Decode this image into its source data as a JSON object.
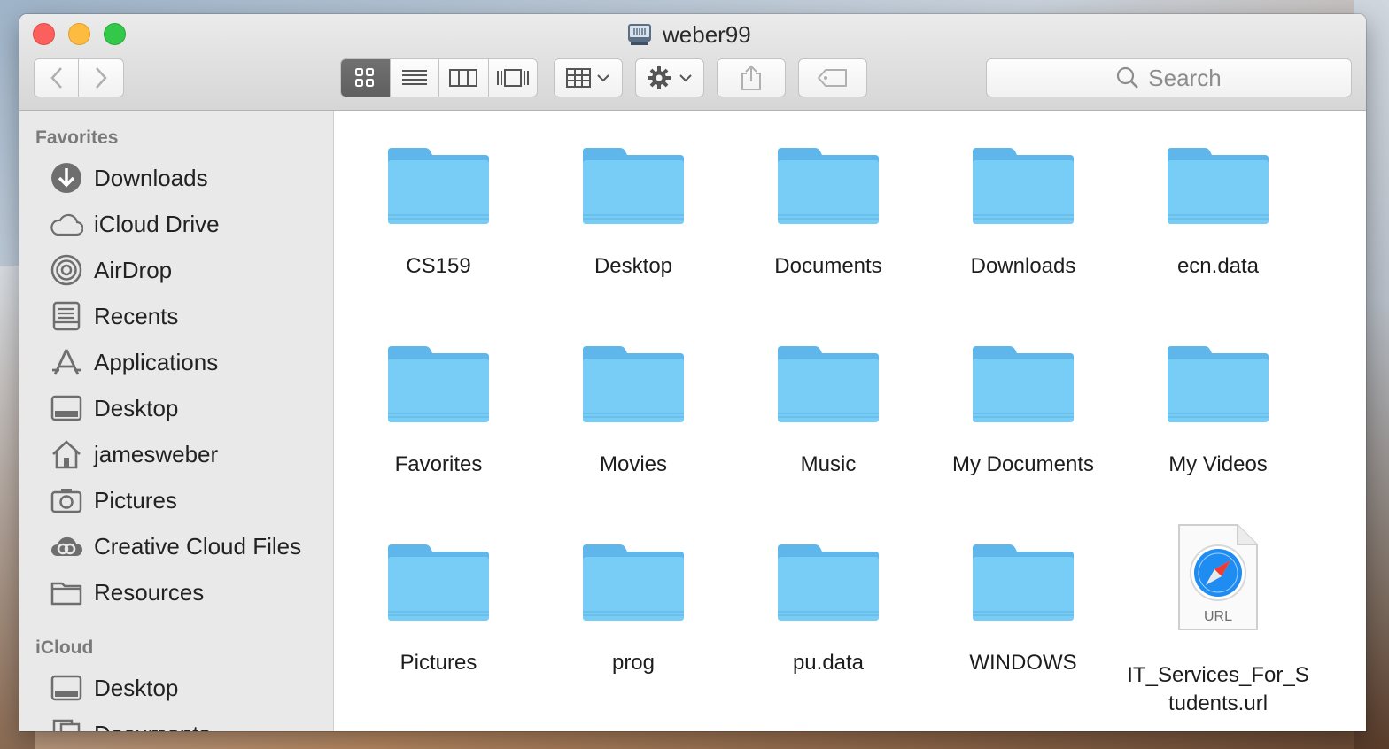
{
  "window": {
    "title": "weber99"
  },
  "toolbar": {
    "back_icon": "chevron-left-icon",
    "forward_icon": "chevron-right-icon",
    "views": [
      "icon-view",
      "list-view",
      "column-view",
      "gallery-view"
    ],
    "active_view": "icon-view",
    "search_placeholder": "Search"
  },
  "sidebar": {
    "sections": [
      {
        "title": "Favorites",
        "items": [
          {
            "label": "Downloads",
            "icon": "download-icon"
          },
          {
            "label": "iCloud Drive",
            "icon": "cloud-icon"
          },
          {
            "label": "AirDrop",
            "icon": "airdrop-icon"
          },
          {
            "label": "Recents",
            "icon": "recents-icon"
          },
          {
            "label": "Applications",
            "icon": "applications-icon"
          },
          {
            "label": "Desktop",
            "icon": "desktop-icon"
          },
          {
            "label": "jamesweber",
            "icon": "home-icon"
          },
          {
            "label": "Pictures",
            "icon": "camera-icon"
          },
          {
            "label": "Creative Cloud Files",
            "icon": "creative-cloud-icon"
          },
          {
            "label": "Resources",
            "icon": "folder-icon"
          }
        ]
      },
      {
        "title": "iCloud",
        "items": [
          {
            "label": "Desktop",
            "icon": "desktop-icon"
          },
          {
            "label": "Documents",
            "icon": "documents-icon"
          }
        ]
      }
    ]
  },
  "files": [
    {
      "name": "CS159",
      "kind": "folder"
    },
    {
      "name": "Desktop",
      "kind": "folder"
    },
    {
      "name": "Documents",
      "kind": "folder"
    },
    {
      "name": "Downloads",
      "kind": "folder"
    },
    {
      "name": "ecn.data",
      "kind": "folder"
    },
    {
      "name": "Favorites",
      "kind": "folder"
    },
    {
      "name": "Movies",
      "kind": "folder"
    },
    {
      "name": "Music",
      "kind": "folder"
    },
    {
      "name": "My Documents",
      "kind": "folder"
    },
    {
      "name": "My Videos",
      "kind": "folder"
    },
    {
      "name": "Pictures",
      "kind": "folder"
    },
    {
      "name": "prog",
      "kind": "folder"
    },
    {
      "name": "pu.data",
      "kind": "folder"
    },
    {
      "name": "WINDOWS",
      "kind": "folder"
    },
    {
      "name": "IT_Services_For_Students.url",
      "kind": "url",
      "badge": "URL"
    }
  ],
  "colors": {
    "folder": "#6cc8f6",
    "close": "#fc605c",
    "minimize": "#fdbc40",
    "maximize": "#34c84a"
  }
}
